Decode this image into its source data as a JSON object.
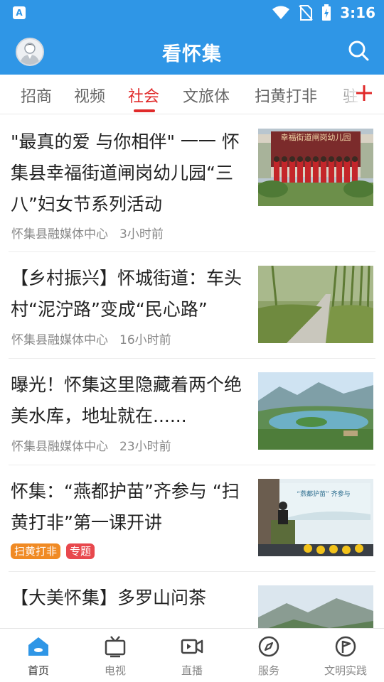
{
  "status_bar": {
    "left_badge": "A",
    "time": "3:16"
  },
  "header": {
    "title": "看怀集"
  },
  "tabs": [
    {
      "label": "招商"
    },
    {
      "label": "视频"
    },
    {
      "label": "社会"
    },
    {
      "label": "文旅体"
    },
    {
      "label": "扫黄打非"
    },
    {
      "label": "驻"
    }
  ],
  "active_tab": "社会",
  "articles": [
    {
      "title": "\"最真的爱 与你相伴\" 一一 怀集县幸福街道闸岗幼儿园“三八”妇女节系列活动",
      "source": "怀集县融媒体中心",
      "time": "3小时前",
      "image": {
        "caption": "幸福街道闸岗幼儿园"
      }
    },
    {
      "title": "【乡村振兴】怀城街道：车头村“泥泞路”变成“民心路”",
      "source": "怀集县融媒体中心",
      "time": "16小时前"
    },
    {
      "title": "曝光！怀集这里隐藏着两个绝美水库，地址就在......",
      "source": "怀集县融媒体中心",
      "time": "23小时前"
    },
    {
      "title": "怀集：“燕都护苗”齐参与 “扫黄打非”第一课开讲",
      "tags": [
        {
          "label": "扫黄打非",
          "color": "#f08a24"
        },
        {
          "label": "专题",
          "color": "#e8484d"
        }
      ],
      "image": {
        "banner": "“燕都护苗” 齐参与"
      }
    },
    {
      "title": "【大美怀集】多罗山问茶"
    }
  ],
  "bottom_nav": [
    {
      "label": "首页",
      "icon": "home-icon",
      "active": true
    },
    {
      "label": "电视",
      "icon": "tv-icon",
      "active": false
    },
    {
      "label": "直播",
      "icon": "live-camera-icon",
      "active": false
    },
    {
      "label": "服务",
      "icon": "compass-icon",
      "active": false
    },
    {
      "label": "文明实践",
      "icon": "flag-icon",
      "active": false
    }
  ],
  "colors": {
    "primary": "#2f96e6",
    "tab_active": "#e02a2a",
    "nav_active": "#2f96e6",
    "tag_orange": "#f08a24",
    "tag_red": "#e8484d"
  }
}
